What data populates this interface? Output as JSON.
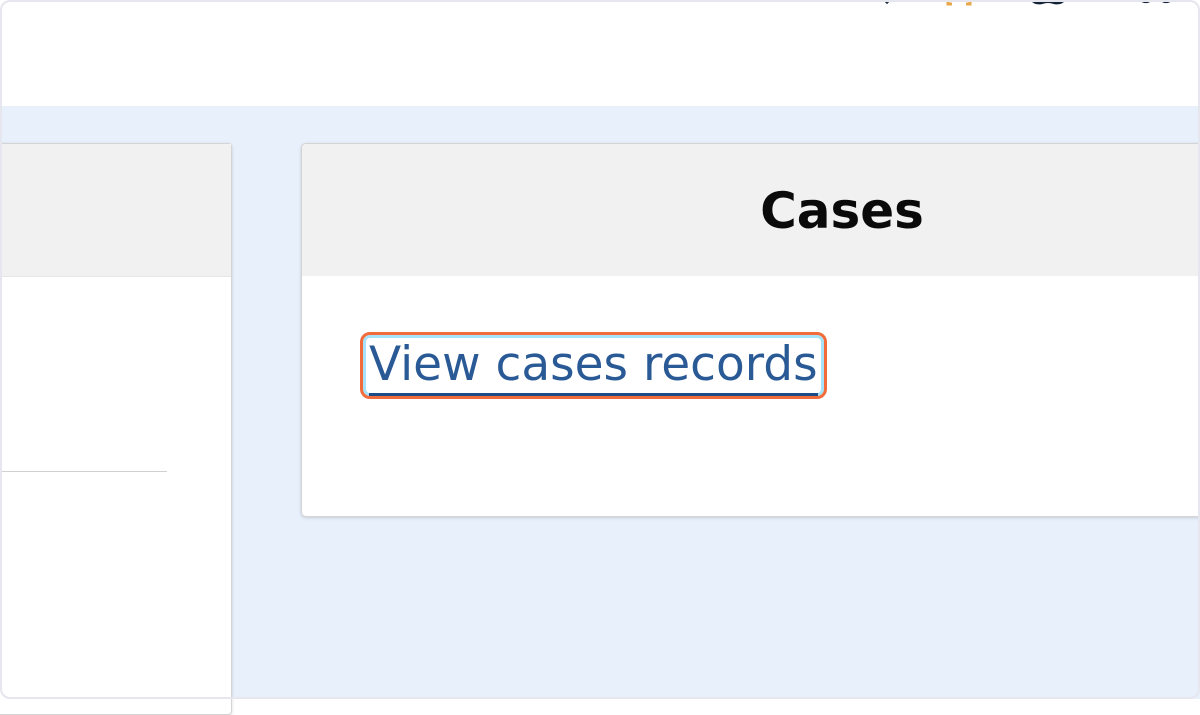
{
  "header": {
    "icons": [
      "chevron-down-icon",
      "brackets-icon",
      "group-icon",
      "user-icon"
    ]
  },
  "cases_card": {
    "title": "Cases",
    "link_label": "View cases records"
  },
  "colors": {
    "background": "#e8f0fc",
    "link": "#2a5a95",
    "highlight": "#f26b3a"
  }
}
